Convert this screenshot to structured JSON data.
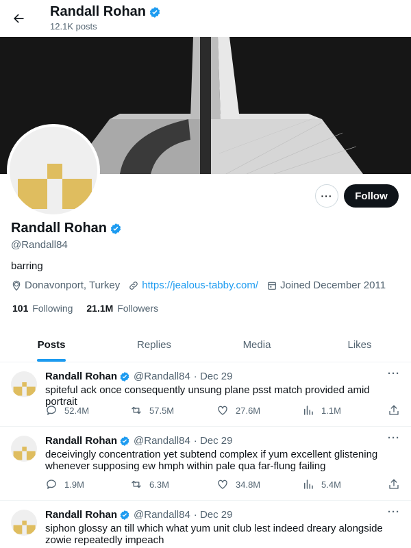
{
  "header": {
    "name": "Randall Rohan",
    "post_count": "12.1K posts"
  },
  "profile": {
    "name": "Randall Rohan",
    "handle": "@Randall84",
    "bio": "barring",
    "location": "Donavonport, Turkey",
    "website": "https://jealous-tabby.com/",
    "joined": "Joined December 2011",
    "following_count": "101",
    "following_label": "Following",
    "followers_count": "21.1M",
    "followers_label": "Followers",
    "more_label": "···",
    "follow_label": "Follow"
  },
  "tabs": [
    {
      "label": "Posts"
    },
    {
      "label": "Replies"
    },
    {
      "label": "Media"
    },
    {
      "label": "Likes"
    }
  ],
  "posts": [
    {
      "author": "Randall Rohan",
      "handle": "@Randall84",
      "date": "· Dec 29",
      "text": "spiteful ack once consequently unsung plane psst match provided amid portrait",
      "replies": "52.4M",
      "retweets": "57.5M",
      "likes": "27.6M",
      "views": "1.1M"
    },
    {
      "author": "Randall Rohan",
      "handle": "@Randall84",
      "date": "· Dec 29",
      "text": "deceivingly concentration yet subtend complex if yum excellent glistening whenever supposing ew hmph within pale qua far-flung failing",
      "replies": "1.9M",
      "retweets": "6.3M",
      "likes": "34.8M",
      "views": "5.4M"
    },
    {
      "author": "Randall Rohan",
      "handle": "@Randall84",
      "date": "· Dec 29",
      "text": "siphon glossy an till which what yum unit club lest indeed dreary alongside zowie repeatedly impeach"
    }
  ],
  "colors": {
    "accent": "#1d9bf0",
    "text": "#0f1419",
    "muted": "#536471",
    "avatar_logo": "#dfbd5f"
  }
}
